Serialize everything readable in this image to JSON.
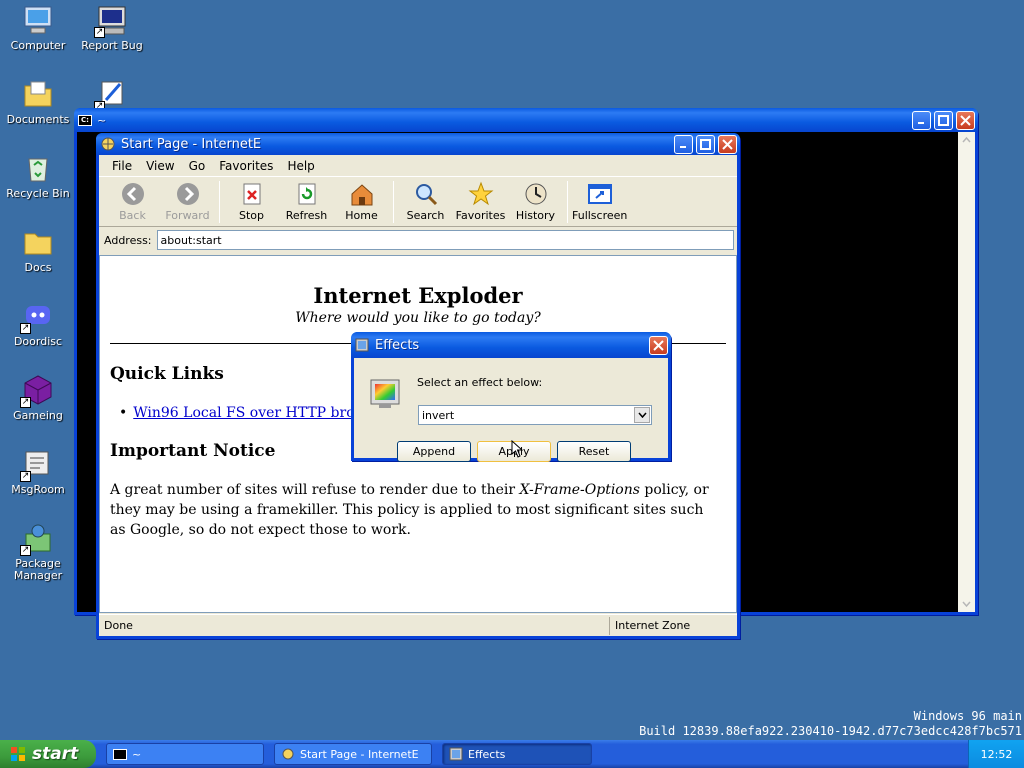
{
  "desktop": {
    "icons": [
      {
        "label": "Computer",
        "icon": "computer-icon"
      },
      {
        "label": "Report Bug",
        "icon": "report-bug-icon"
      },
      {
        "label": "Documents",
        "icon": "documents-icon"
      },
      {
        "label": "Recycle Bin",
        "icon": "recycle-bin-icon"
      },
      {
        "label": "Docs",
        "icon": "folder-icon"
      },
      {
        "label": "Doordisc",
        "icon": "doordisc-icon"
      },
      {
        "label": "Gameing",
        "icon": "gameing-icon"
      },
      {
        "label": "MsgRoom",
        "icon": "msgroom-icon"
      },
      {
        "label": "Package Manager",
        "icon": "package-manager-icon"
      }
    ],
    "watermark": {
      "line1": "Windows 96 main",
      "line2": "Build 12839.88efa922.230410-1942.d77c73edcc428f7bc571"
    }
  },
  "terminal_window": {
    "title": "~"
  },
  "browser": {
    "title": "Start Page - InternetE",
    "menu": [
      "File",
      "View",
      "Go",
      "Favorites",
      "Help"
    ],
    "toolbar": [
      {
        "label": "Back",
        "icon": "back-arrow-icon",
        "enabled": false
      },
      {
        "label": "Forward",
        "icon": "forward-arrow-icon",
        "enabled": false
      },
      {
        "label": "Stop",
        "icon": "stop-icon",
        "enabled": true
      },
      {
        "label": "Refresh",
        "icon": "refresh-icon",
        "enabled": true
      },
      {
        "label": "Home",
        "icon": "home-icon",
        "enabled": true
      },
      {
        "label": "Search",
        "icon": "search-icon",
        "enabled": true
      },
      {
        "label": "Favorites",
        "icon": "star-icon",
        "enabled": true
      },
      {
        "label": "History",
        "icon": "history-icon",
        "enabled": true
      },
      {
        "label": "Fullscreen",
        "icon": "fullscreen-icon",
        "enabled": true
      }
    ],
    "address_label": "Address:",
    "address_value": "about:start",
    "page": {
      "heading": "Internet Exploder",
      "tagline": "Where would you like to go today?",
      "quick_links_heading": "Quick Links",
      "link_text": "Win96 Local FS over HTTP brov",
      "notice_heading": "Important Notice",
      "notice_text_1": "A great number of sites will refuse to render due to their ",
      "notice_italic": "X-Frame-Options",
      "notice_text_2": " policy, or they may be using a framekiller. This policy is applied to most significant sites such as Google, so do not expect those to work."
    },
    "status_text": "Done",
    "zone_text": "Internet Zone"
  },
  "effects_dialog": {
    "title": "Effects",
    "prompt": "Select an effect below:",
    "selected_effect": "invert",
    "buttons": {
      "append": "Append",
      "apply": "Apply",
      "reset": "Reset"
    }
  },
  "taskbar": {
    "start_label": "start",
    "tasks": [
      {
        "label": "~"
      },
      {
        "label": "Start Page - InternetE"
      },
      {
        "label": "Effects"
      }
    ],
    "clock": "12:52"
  }
}
